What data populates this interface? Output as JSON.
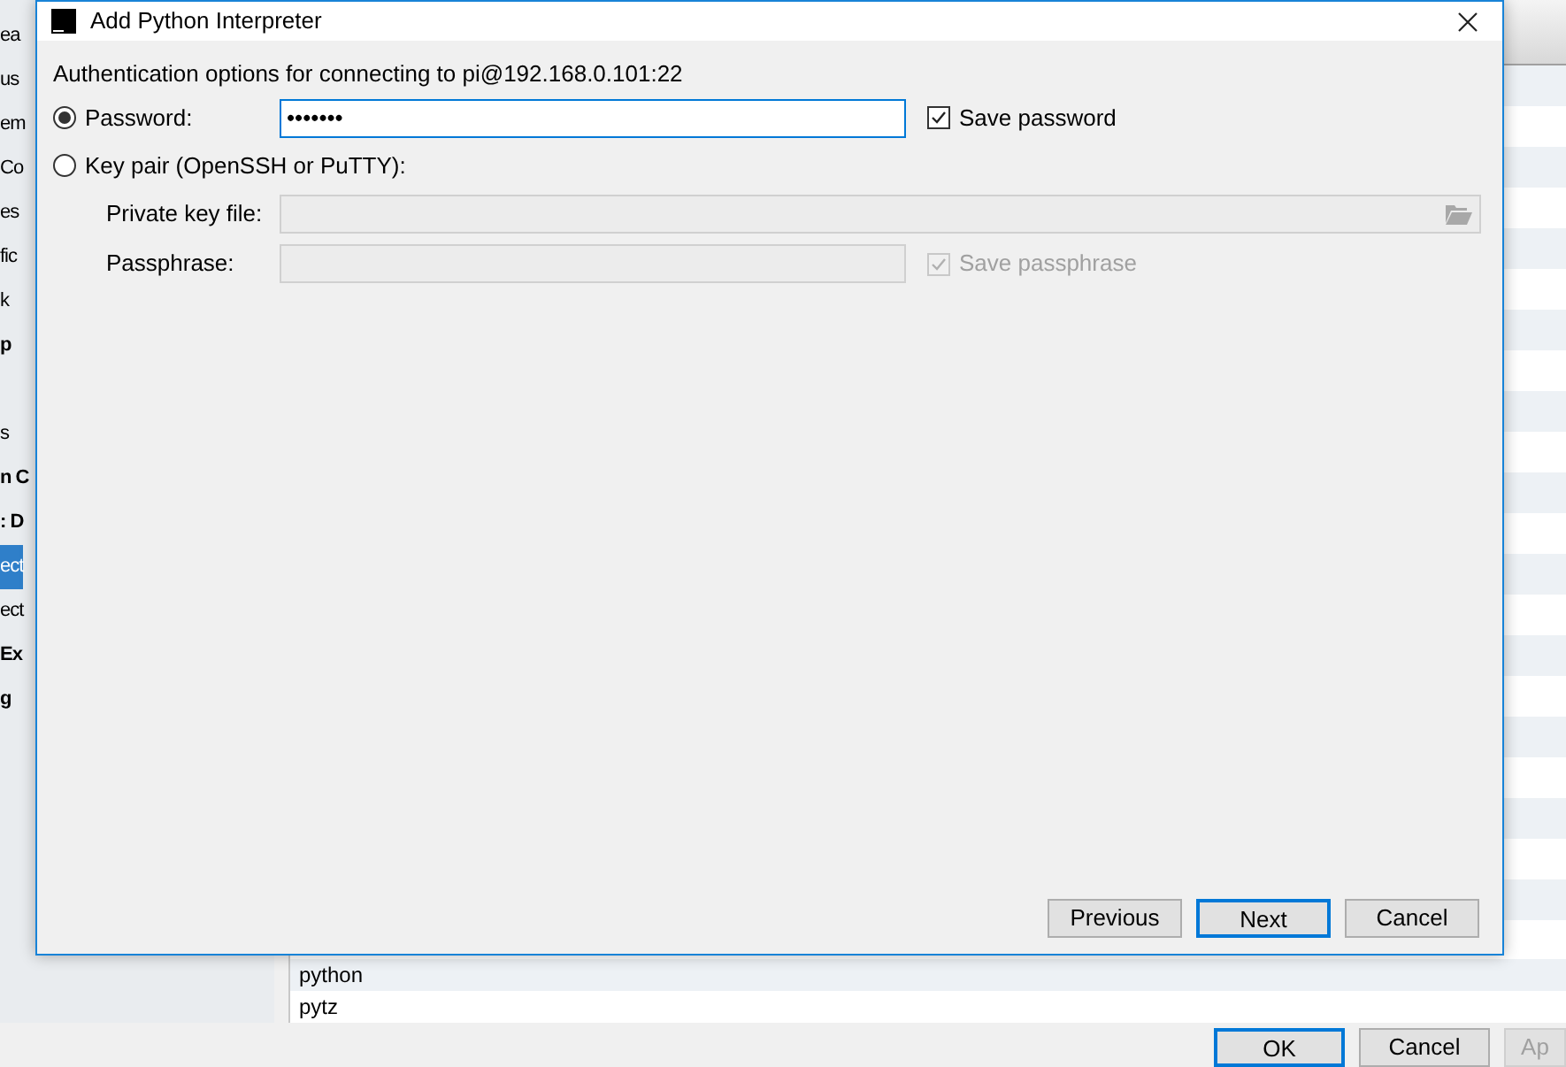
{
  "background_window": {
    "sidebar": {
      "groups": [
        [
          {
            "label": "ea",
            "bold": false,
            "selected": false
          },
          {
            "label": "us",
            "bold": false,
            "selected": false
          },
          {
            "label": "em",
            "bold": false,
            "selected": false
          },
          {
            "label": "Co",
            "bold": false,
            "selected": false
          },
          {
            "label": "es",
            "bold": false,
            "selected": false
          },
          {
            "label": "fic",
            "bold": false,
            "selected": false
          },
          {
            "label": "k",
            "bold": false,
            "selected": false
          },
          {
            "label": "p",
            "bold": true,
            "selected": false
          }
        ],
        [
          {
            "label": "s",
            "bold": false,
            "selected": false
          },
          {
            "label": "n C",
            "bold": true,
            "selected": false
          },
          {
            "label": ": D",
            "bold": true,
            "selected": false
          },
          {
            "label": "ect",
            "bold": false,
            "selected": true
          },
          {
            "label": "ect",
            "bold": false,
            "selected": false
          },
          {
            "label": "Ex",
            "bold": true,
            "selected": false
          },
          {
            "label": "g",
            "bold": true,
            "selected": false
          }
        ]
      ]
    },
    "table": {
      "rows": [
        {
          "column_1": "python"
        },
        {
          "column_1": "pytz"
        }
      ]
    },
    "buttons": [
      {
        "label": "OK",
        "default": true
      },
      {
        "label": "Cancel",
        "default": false
      },
      {
        "label": "Ap",
        "default": false
      }
    ]
  },
  "dialog": {
    "title": "Add Python Interpreter",
    "heading": "Authentication options for connecting to pi@192.168.0.101:22",
    "options": [
      {
        "kind": "radio",
        "label": "Password:",
        "selected": true
      },
      {
        "kind": "radio",
        "label": "Key pair (OpenSSH or PuTTY):",
        "selected": false
      }
    ],
    "password": {
      "value": "•••••••"
    },
    "save_password": {
      "label": "Save password",
      "checked": true,
      "disabled": false
    },
    "private_key_file": {
      "label": "Private key file:",
      "disabled": true
    },
    "passphrase": {
      "label": "Passphrase:",
      "disabled": true
    },
    "save_passphrase": {
      "label": "Save passphrase",
      "checked": true,
      "disabled": true
    },
    "buttons": [
      {
        "label": "Previous",
        "default": false
      },
      {
        "label": "Next",
        "default": true
      },
      {
        "label": "Cancel",
        "default": false
      }
    ]
  }
}
